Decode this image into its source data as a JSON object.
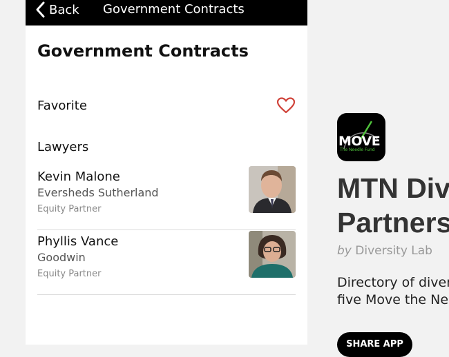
{
  "navbar": {
    "back_label": "Back",
    "title": "Government Contracts"
  },
  "page": {
    "title": "Government Contracts",
    "favorite_label": "Favorite",
    "favorite_icon": "heart-outline-icon",
    "favorite_color": "#d0433a",
    "section_label": "Lawyers"
  },
  "lawyers": [
    {
      "name": "Kevin Malone",
      "firm": "Eversheds Sutherland",
      "role": "Equity Partner"
    },
    {
      "name": "Phyllis Vance",
      "firm": "Goodwin",
      "role": "Equity Partner"
    }
  ],
  "promo": {
    "app_icon_text": "MOVE",
    "app_icon_subtext": "The Needle Fund",
    "title_line1": "MTN Div",
    "title_line2": "Partners",
    "by_prefix": "by",
    "by_name": "Diversity Lab",
    "desc_line1": "Directory of diver",
    "desc_line2": "five Move the Ne",
    "share_label": "SHARE APP"
  }
}
